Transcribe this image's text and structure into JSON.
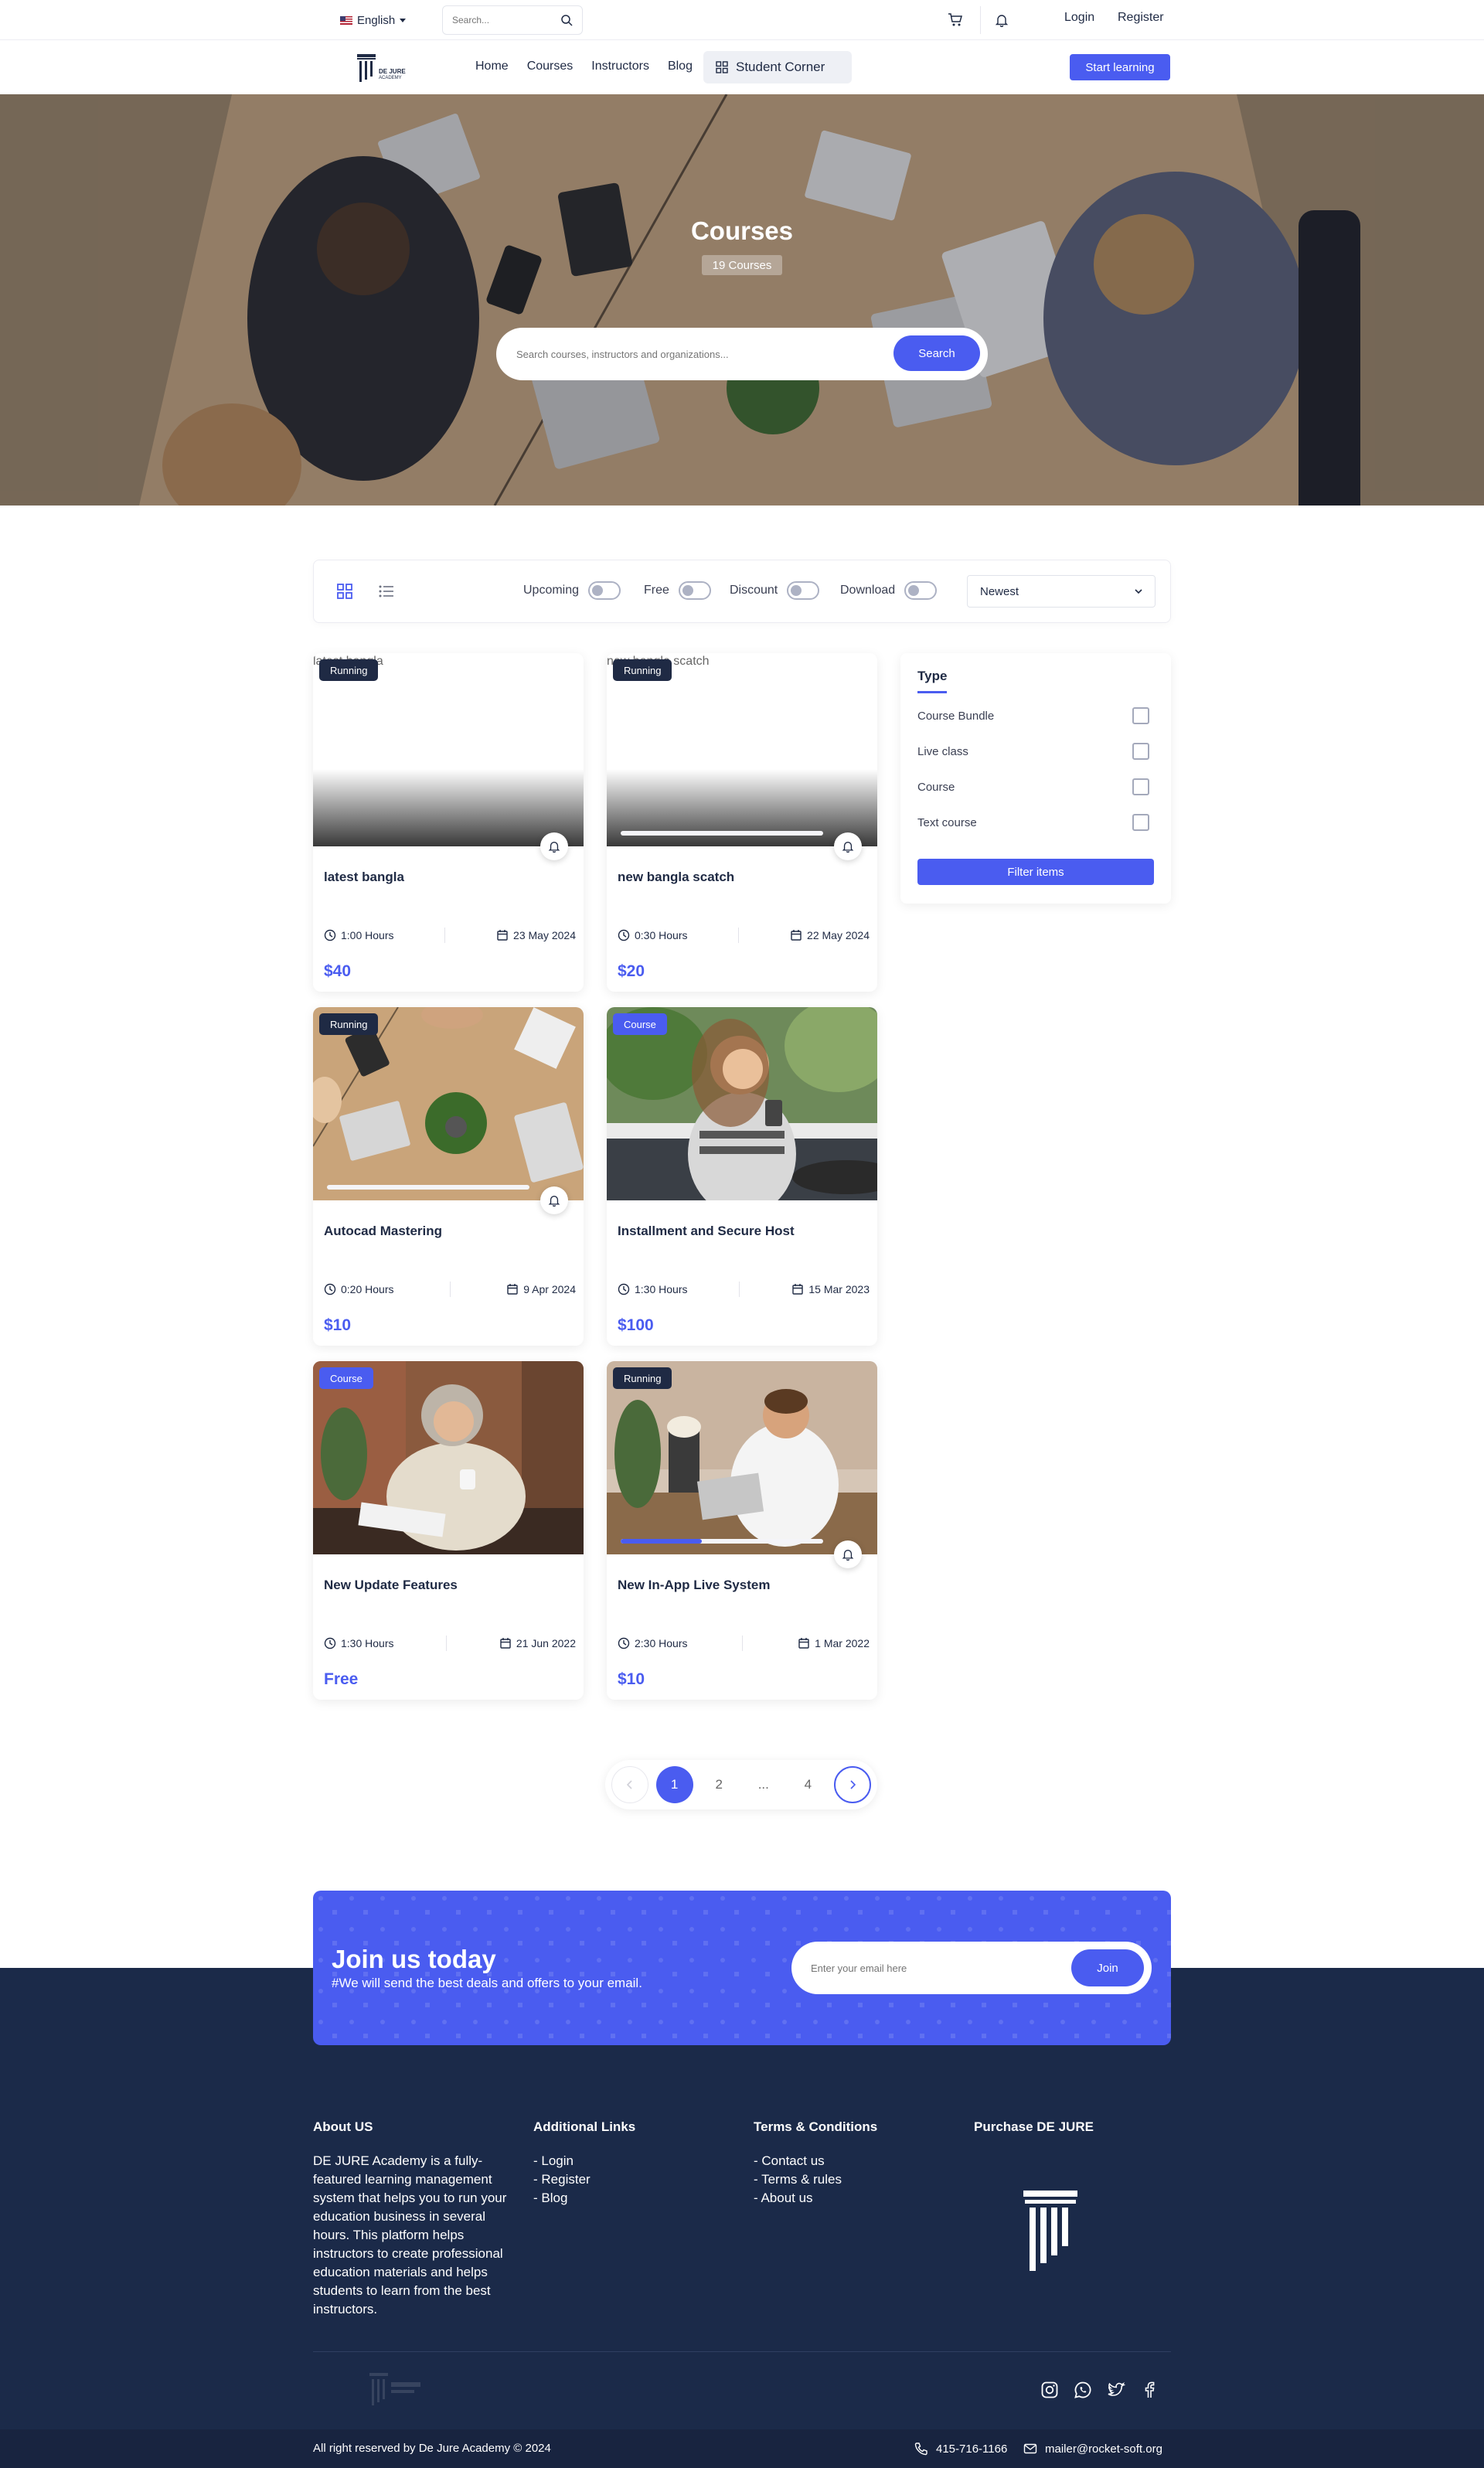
{
  "topbar": {
    "language": "English",
    "search_placeholder": "Search...",
    "login": "Login",
    "register": "Register"
  },
  "nav": {
    "logo_line1": "DE JURE",
    "logo_line2": "ACADEMY",
    "items": [
      "Home",
      "Courses",
      "Instructors",
      "Blog"
    ],
    "student_corner": "Student Corner",
    "start_learning": "Start learning"
  },
  "hero": {
    "title": "Courses",
    "count": "19 Courses",
    "search_placeholder": "Search courses, instructors and organizations...",
    "search_button": "Search"
  },
  "filters": {
    "toggles": [
      "Upcoming",
      "Free",
      "Discount",
      "Download"
    ],
    "sort": "Newest"
  },
  "courses": [
    {
      "title": "latest bangla",
      "badge": "Running",
      "hours": "1:00 Hours",
      "date": "23 May 2024",
      "price": "$40",
      "img_alt": "latest bangla",
      "progress": null
    },
    {
      "title": "new bangla scatch",
      "badge": "Running",
      "hours": "0:30 Hours",
      "date": "22 May 2024",
      "price": "$20",
      "img_alt": "new bangla scatch",
      "progress": 0
    },
    {
      "title": "Autocad Mastering",
      "badge": "Running",
      "hours": "0:20 Hours",
      "date": "9 Apr 2024",
      "price": "$10",
      "progress": 0
    },
    {
      "title": "Installment and Secure Host",
      "badge": "Course",
      "hours": "1:30 Hours",
      "date": "15 Mar 2023",
      "price": "$100",
      "progress": null
    },
    {
      "title": "New Update Features",
      "badge": "Course",
      "hours": "1:30 Hours",
      "date": "21 Jun 2022",
      "price": "Free",
      "progress": null
    },
    {
      "title": "New In-App Live System",
      "badge": "Running",
      "hours": "2:30 Hours",
      "date": "1 Mar 2022",
      "price": "$10",
      "progress": 0.4
    }
  ],
  "sidebar": {
    "title": "Type",
    "options": [
      "Course Bundle",
      "Live class",
      "Course",
      "Text course"
    ],
    "button": "Filter items"
  },
  "pagination": {
    "pages": [
      "1",
      "2",
      "...",
      "4"
    ],
    "current": "1"
  },
  "newsletter": {
    "title": "Join us today",
    "subtitle": "#We will send the best deals and offers to your email.",
    "placeholder": "Enter your email here",
    "button": "Join"
  },
  "footer": {
    "about_title": "About US",
    "about_text": "DE JURE Academy is a fully-featured learning management system that helps you to run your education business in several hours. This platform helps instructors to create professional education materials and helps students to learn from the best instructors.",
    "additional_title": "Additional Links",
    "additional_links": [
      "- Login",
      "- Register",
      "- Blog"
    ],
    "terms_title": "Terms & Conditions",
    "terms_links": [
      "- Contact us",
      "- Terms & rules",
      "- About us"
    ],
    "purchase_title": "Purchase DE JURE",
    "copyright": "All right reserved by De Jure Academy © 2024",
    "phone": "415-716-1166",
    "email": "mailer@rocket-soft.org"
  },
  "colors": {
    "accent": "#4a5cf0",
    "navy": "#1b2a49",
    "dark": "#1f2a44"
  }
}
